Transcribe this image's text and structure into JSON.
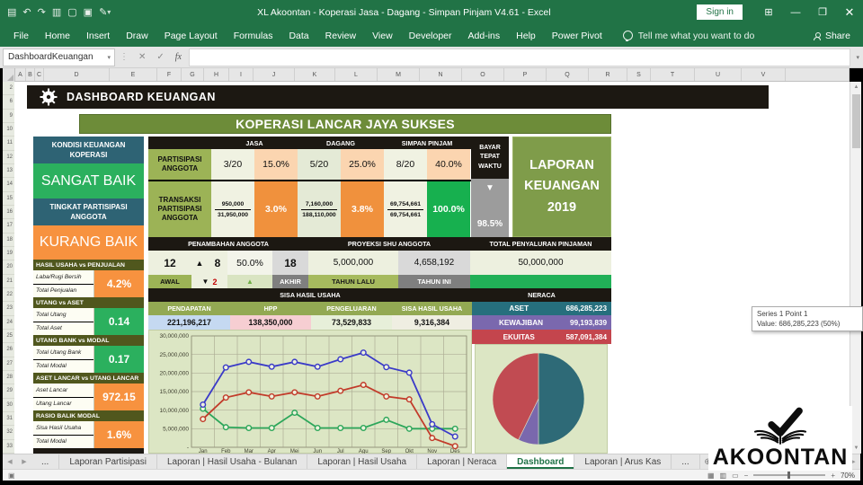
{
  "window": {
    "title": "XL Akoontan - Koperasi Jasa - Dagang - Simpan Pinjam V4.61  -  Excel",
    "sign_in": "Sign in",
    "qat": [
      {
        "name": "save",
        "glyph": "▤"
      },
      {
        "name": "undo",
        "glyph": "↶"
      },
      {
        "name": "redo",
        "glyph": "↷"
      },
      {
        "name": "print-preview",
        "glyph": "▥"
      },
      {
        "name": "document",
        "glyph": "▢"
      },
      {
        "name": "new-sheet",
        "glyph": "▣"
      },
      {
        "name": "pen",
        "glyph": "✎"
      }
    ],
    "controls": [
      {
        "name": "ribbon-display-options",
        "glyph": "⊞"
      },
      {
        "name": "minimize",
        "glyph": "—"
      },
      {
        "name": "restore-down",
        "glyph": "❐"
      },
      {
        "name": "close",
        "glyph": "✕"
      }
    ]
  },
  "ribbon": {
    "tabs": [
      "File",
      "Home",
      "Insert",
      "Draw",
      "Page Layout",
      "Formulas",
      "Data",
      "Review",
      "View",
      "Developer",
      "Add-ins",
      "Help",
      "Power Pivot"
    ],
    "search": "Tell me what you want to do",
    "share": "Share"
  },
  "formula_bar": {
    "name_box": "DashboardKeuangan",
    "cancel_icon": "✕",
    "enter_icon": "✓",
    "fx_icon": "fx",
    "dots_icon": "⋮",
    "caret_icon": "▾"
  },
  "grid": {
    "columns": [
      "A",
      "B",
      "C",
      "D",
      "E",
      "F",
      "G",
      "H",
      "I",
      "J",
      "K",
      "L",
      "M",
      "N",
      "O",
      "P",
      "Q",
      "R",
      "S",
      "T",
      "U",
      "V"
    ],
    "rows": [
      "2",
      "6",
      "9",
      "10",
      "11",
      "12",
      "13",
      "14",
      "15",
      "16",
      "17",
      "18",
      "19",
      "20",
      "21",
      "22",
      "23",
      "24",
      "25",
      "26",
      "27",
      "28",
      "29",
      "30",
      "31",
      "32",
      "33"
    ]
  },
  "dashboard": {
    "header": "DASHBOARD KEUANGAN",
    "title": "KOPERASI LANCAR JAYA SUKSES",
    "left_panel": {
      "status1_label": "KONDISI KEUANGAN KOPERASI",
      "status1_value": "SANGAT BAIK",
      "status2_label": "TINGKAT PARTISIPASI ANGGOTA",
      "status2_value": "KURANG BAIK",
      "ratios": [
        {
          "header": "HASIL USAHA vs PENJUALAN",
          "num": "Laba/Rugi Bersih",
          "den": "Total Penjualan",
          "value": "4.2%"
        },
        {
          "header": "UTANG vs ASET",
          "num": "Total Utang",
          "den": "Total Aset",
          "value": "0.14"
        },
        {
          "header": "UTANG BANK vs MODAL",
          "num": "Total Utang Bank",
          "den": "Total Modal",
          "value": "0.17"
        },
        {
          "header": "ASET LANCAR vs UTANG LANCAR",
          "num": "Aset Lancar",
          "den": "Utang Lancar",
          "value": "972.15"
        },
        {
          "header": "RASIO BALIK MODAL",
          "num": "Sisa Hasil Usaha",
          "den": "Total Modal",
          "value": "1.6%"
        }
      ]
    },
    "participation": {
      "row1_label": "PARTISIPASI ANGGOTA",
      "row2_label": "TRANSAKSI PARTISIPASI ANGGOTA",
      "bayar_label": "BAYAR TEPAT WAKTU",
      "bayar_arrow": "▼",
      "bayar_value": "98.5%",
      "groups": [
        {
          "name": "JASA",
          "ratio": "3/20",
          "ratio_pct": "15.0%",
          "num": "950,000",
          "den": "31,950,000",
          "pct": "3.0%"
        },
        {
          "name": "DAGANG",
          "ratio": "5/20",
          "ratio_pct": "25.0%",
          "num": "7,160,000",
          "den": "188,110,000",
          "pct": "3.8%"
        },
        {
          "name": "SIMPAN PINJAM",
          "ratio": "8/20",
          "ratio_pct": "40.0%",
          "num": "69,754,661",
          "den": "69,754,661",
          "pct": "100.0%"
        }
      ]
    },
    "laporan_box": {
      "line1": "LAPORAN",
      "line2": "KEUANGAN",
      "line3": "2019"
    },
    "members": {
      "headers": [
        "PENAMBAHAN ANGGOTA",
        "PROYEKSI SHU ANGGOTA",
        "TOTAL PENYALURAN PINJAMAN"
      ],
      "awal": "12",
      "delta_up_icon": "▲",
      "delta_up": "8",
      "pct": "50.0%",
      "akhir": "18",
      "tahun_lalu_value": "5,000,000",
      "tahun_ini_value": "4,658,192",
      "penyaluran": "50,000,000",
      "label_awal": "AWAL",
      "delta_down_icon": "▼",
      "delta_down": "2",
      "trend_icon": "▲",
      "label_akhir": "AKHIR",
      "label_tahun_lalu": "TAHUN LALU",
      "label_tahun_ini": "TAHUN INI"
    },
    "shu": {
      "header": "SISA HASIL USAHA",
      "cols": [
        {
          "label": "PENDAPATAN",
          "value": "221,196,217",
          "bg": "#c5d9f1"
        },
        {
          "label": "HPP",
          "value": "138,350,000",
          "bg": "#f6ced2"
        },
        {
          "label": "PENGELUARAN",
          "value": "73,529,833",
          "bg": "#e7efd9"
        },
        {
          "label": "SISA HASIL USAHA",
          "value": "9,316,384",
          "bg": "#efeee2"
        }
      ]
    },
    "neraca": {
      "header": "NERACA",
      "rows": [
        {
          "label": "ASET",
          "value": "686,285,223",
          "color": "#266f7d"
        },
        {
          "label": "KEWAJIBAN",
          "value": "99,193,839",
          "color": "#7a68ae"
        },
        {
          "label": "EKUITAS",
          "value": "587,091,384",
          "color": "#c4454d"
        }
      ]
    }
  },
  "chart_data": [
    {
      "type": "line",
      "title": "SISA HASIL USAHA",
      "categories": [
        "Jan",
        "Feb",
        "Mar",
        "Apr",
        "Mei",
        "Jun",
        "Jul",
        "Agu",
        "Sep",
        "Okt",
        "Nov",
        "Des"
      ],
      "series": [
        {
          "name": "Pendapatan",
          "color": "#3a3ac8",
          "values": [
            11500000,
            21500000,
            23000000,
            21700000,
            23000000,
            21700000,
            23700000,
            25500000,
            21600000,
            20100000,
            6200000,
            2900000
          ]
        },
        {
          "name": "HPP",
          "color": "#c23b2a",
          "values": [
            7600000,
            13400000,
            14800000,
            13700000,
            14800000,
            13700000,
            15200000,
            16800000,
            13700000,
            12900000,
            2500000,
            300000
          ]
        },
        {
          "name": "Pengeluaran",
          "color": "#2ca65a",
          "values": [
            10400000,
            5400000,
            5200000,
            5200000,
            9300000,
            5200000,
            5200000,
            5200000,
            7400000,
            5000000,
            5000000,
            5000000
          ]
        }
      ],
      "ylim": [
        0,
        30000000
      ],
      "ytick_step": 5000000,
      "grid": true,
      "legend": "none"
    },
    {
      "type": "pie",
      "title": "NERACA",
      "labels": [
        "ASET",
        "KEWAJIBAN",
        "EKUITAS"
      ],
      "values": [
        686285223,
        99193839,
        587091384
      ],
      "percents": [
        "50.0%",
        "7.2%",
        "42.8%"
      ],
      "colors": [
        "#2e6a77",
        "#7a68ad",
        "#c14b52"
      ],
      "legend": "none"
    }
  ],
  "tooltip": {
    "line1": "Series 1 Point 1",
    "line2": "Value: 686,285,223 (50%)"
  },
  "sheet_tabs": {
    "prev_icon": "◀",
    "next_icon": "▶",
    "add_icon": "⊕",
    "items": [
      {
        "label": "...",
        "active": false
      },
      {
        "label": "Laporan Partisipasi",
        "active": false
      },
      {
        "label": "Laporan | Hasil Usaha - Bulanan",
        "active": false
      },
      {
        "label": "Laporan | Hasil Usaha",
        "active": false
      },
      {
        "label": "Laporan | Neraca",
        "active": false
      },
      {
        "label": "Dashboard",
        "active": true
      },
      {
        "label": "Laporan | Arus Kas",
        "active": false
      },
      {
        "label": "...",
        "active": false
      }
    ]
  },
  "status_bar": {
    "ready_icon": "▣",
    "view_icons": [
      {
        "name": "normal-view",
        "glyph": "▦"
      },
      {
        "name": "page-layout-view",
        "glyph": "▥"
      },
      {
        "name": "page-break-view",
        "glyph": "▭"
      }
    ],
    "zoom_out": "−",
    "zoom_in": "+",
    "zoom": "70%"
  },
  "logo": {
    "text": "AKOONTAN"
  }
}
